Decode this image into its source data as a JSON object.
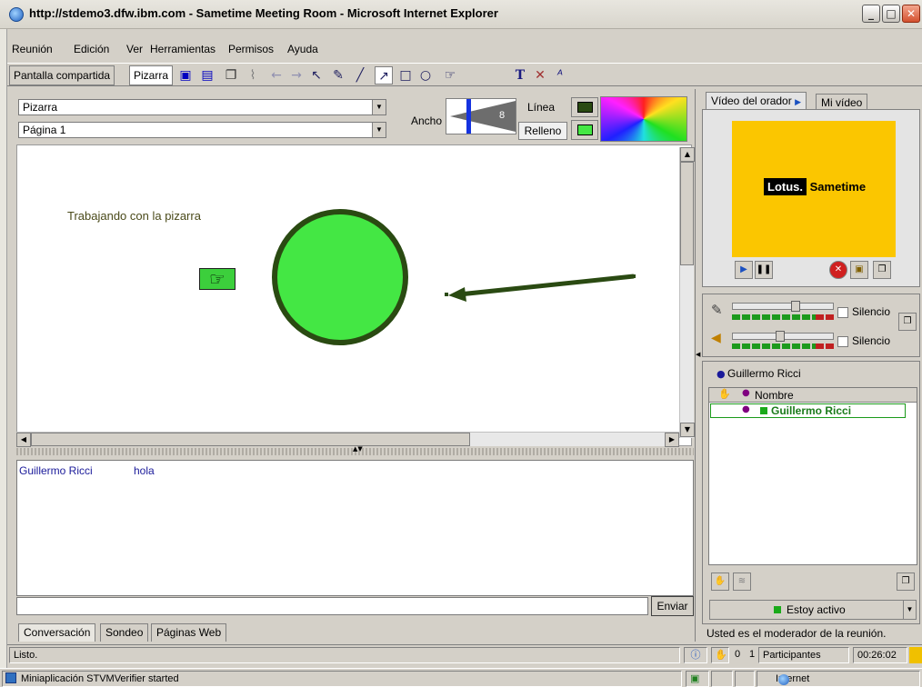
{
  "window": {
    "title": "http://stdemo3.dfw.ibm.com - Sametime Meeting Room - Microsoft Internet Explorer"
  },
  "menu": {
    "items": [
      "Reunión",
      "Edición",
      "Ver",
      "Herramientas",
      "Permisos",
      "Ayuda"
    ]
  },
  "toolbar": {
    "tab_shared_screen": "Pantalla compartida",
    "tab_whiteboard": "Pizarra",
    "tools": [
      {
        "name": "select-arrow",
        "glyph": "↖"
      },
      {
        "name": "pen",
        "glyph": "✎"
      },
      {
        "name": "line",
        "glyph": "╱"
      },
      {
        "name": "arrow-line",
        "glyph": "↗"
      },
      {
        "name": "rectangle",
        "glyph": "□"
      },
      {
        "name": "ellipse",
        "glyph": "○"
      },
      {
        "name": "pointer-hand",
        "glyph": "☞"
      },
      {
        "name": "text",
        "glyph": "T"
      },
      {
        "name": "eraser",
        "glyph": "✕"
      },
      {
        "name": "font",
        "glyph": "ᴬ"
      }
    ]
  },
  "whiteboard": {
    "board_select": "Pizarra",
    "page_select": "Página 1",
    "width_label": "Ancho",
    "width_value": "8",
    "line_label": "Línea",
    "fill_label": "Relleno",
    "line_color": "#2a4a12",
    "fill_color": "#44e744",
    "canvas_text": "Trabajando con la pizarra"
  },
  "chat": {
    "messages": [
      {
        "author": "Guillermo Ricci",
        "text": "hola"
      }
    ],
    "send_label": "Enviar",
    "tabs": [
      "Conversación",
      "Sondeo",
      "Páginas Web"
    ]
  },
  "video": {
    "tab_speaker": "Vídeo del orador",
    "tab_mine": "Mi vídeo",
    "logo_lotus": "Lotus.",
    "logo_sametime": "Sametime",
    "bg_color": "#fbc600"
  },
  "audio": {
    "mute_label_1": "Silencio",
    "mute_label_2": "Silencio"
  },
  "participants": {
    "header_name": "Guillermo Ricci",
    "column_name": "Nombre",
    "rows": [
      "Guillermo Ricci"
    ],
    "status": "Estoy activo",
    "moderator_note": "Usted es el moderador de la reunión."
  },
  "statusbar": {
    "text": "Listo.",
    "hand_count": "0",
    "participants_count": "1",
    "participants_label": "Participantes",
    "elapsed": "00:26:02"
  },
  "browser_status": {
    "text": "Miniaplicación STVMVerifier started",
    "zone": "Internet"
  }
}
